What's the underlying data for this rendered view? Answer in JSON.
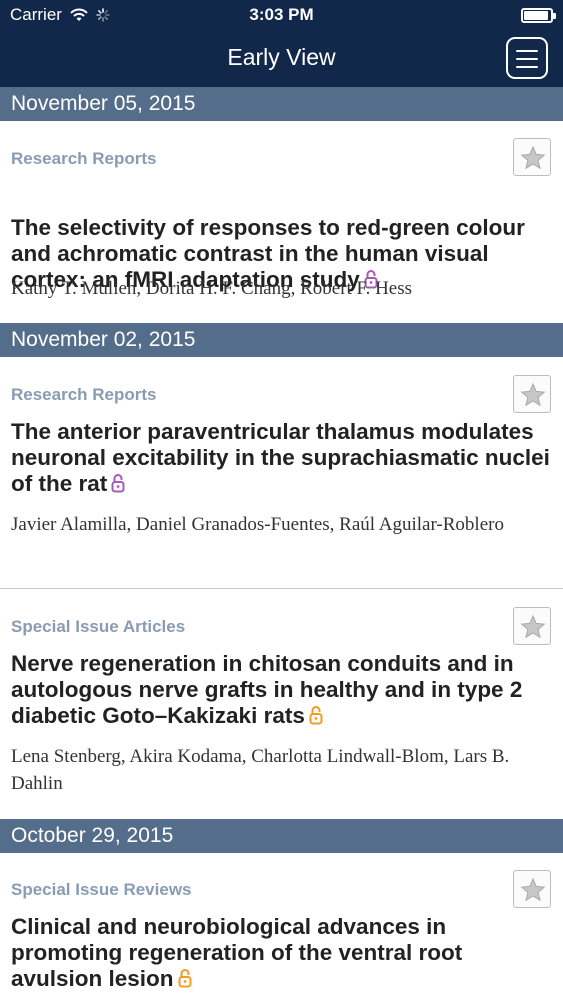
{
  "status_bar": {
    "carrier": "Carrier",
    "time": "3:03 PM",
    "icons": [
      "wifi-icon",
      "activity-spinner-icon",
      "battery-icon"
    ]
  },
  "nav_bar": {
    "title": "Early View",
    "menu_icon": "hamburger-menu-icon"
  },
  "colors": {
    "nav_background": "#12284a",
    "date_header_background": "#546d8a",
    "category_text": "#8a9bb3",
    "open_access_purple": "#a35bb5",
    "open_access_orange": "#f39b22"
  },
  "feed": [
    {
      "date": "November 05, 2015",
      "articles": [
        {
          "category": "Research Reports",
          "title": "The selectivity of responses to red-green colour and achromatic contrast in the human visual cortex: an fMRI adaptation study",
          "authors": "Kathy T. Mullen, Dorita H. F. Chang, Robert F. Hess",
          "open_access_icon": "lock-open-icon",
          "open_access_color": "purple"
        }
      ]
    },
    {
      "date": "November 02, 2015",
      "articles": [
        {
          "category": "Research Reports",
          "title": "The anterior paraventricular thalamus modulates neuronal excitability in the suprachiasmatic nuclei of the rat",
          "authors": "Javier Alamilla, Daniel Granados-Fuentes, Raúl Aguilar-Roblero",
          "open_access_icon": "lock-open-icon",
          "open_access_color": "purple"
        },
        {
          "category": "Special Issue Articles",
          "title": "Nerve regeneration in chitosan conduits and in autologous nerve grafts in healthy and in type 2 diabetic Goto–Kakizaki rats",
          "authors": "Lena Stenberg, Akira Kodama, Charlotta Lindwall-Blom, Lars B. Dahlin",
          "open_access_icon": "lock-open-icon",
          "open_access_color": "orange"
        }
      ]
    },
    {
      "date": "October 29, 2015",
      "articles": [
        {
          "category": "Special Issue Reviews",
          "title": "Clinical and neurobiological advances in promoting regeneration of the ventral root avulsion lesion",
          "open_access_icon": "lock-open-icon",
          "open_access_color": "orange"
        }
      ]
    }
  ]
}
